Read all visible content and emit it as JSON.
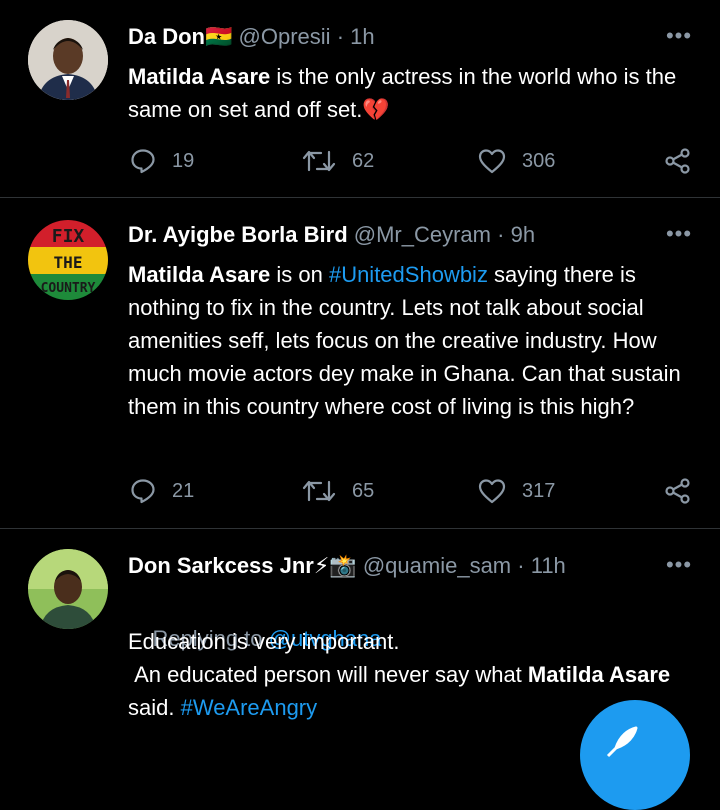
{
  "tweets": [
    {
      "name": "Da Don",
      "flag": "🇬🇭",
      "handle": "@Opresii",
      "time": "1h",
      "body": [
        {
          "t": "Matilda Asare",
          "b": true
        },
        {
          "t": " is the only actress in the world who is the same on set and off set.💔"
        }
      ],
      "replies": "19",
      "retweets": "62",
      "likes": "306",
      "avatar": "person-avatar"
    },
    {
      "name": "Dr. Ayigbe Borla Bird",
      "handle": "@Mr_Ceyram",
      "time": "9h",
      "body": [
        {
          "t": "Matilda Asare",
          "b": true
        },
        {
          "t": " is on "
        },
        {
          "t": "#UnitedShowbiz",
          "link": true
        },
        {
          "t": " saying there is nothing to fix in the country. Lets not talk about social amenities seff, lets focus on the creative industry. How much movie actors dey make in Ghana. Can that sustain them in this country where cost of living is this high?"
        }
      ],
      "replies": "21",
      "retweets": "65",
      "likes": "317",
      "avatar_text": [
        "FIX",
        "THE",
        "COUNTRY"
      ]
    },
    {
      "name": "Don Sarkcess Jnr⚡📸",
      "handle": "@quamie_sam",
      "time": "11h",
      "replying_label": "Replying to ",
      "replying_to": "@utvghana",
      "body": [
        {
          "t": "Education is very important.\n An educated person will never say what "
        },
        {
          "t": "Matilda Asare",
          "b": true
        },
        {
          "t": " said. "
        },
        {
          "t": "#WeAreAngry",
          "link": true
        }
      ],
      "avatar": "person-avatar"
    }
  ],
  "more_label": "•••",
  "colors": {
    "background": "#000000",
    "muted": "#8b98a5",
    "link": "#1d9bf0",
    "separator": "#2f3336"
  },
  "icons": {
    "reply": "reply-icon",
    "retweet": "retweet-icon",
    "like": "like-icon",
    "share": "share-icon",
    "compose": "compose-icon"
  }
}
